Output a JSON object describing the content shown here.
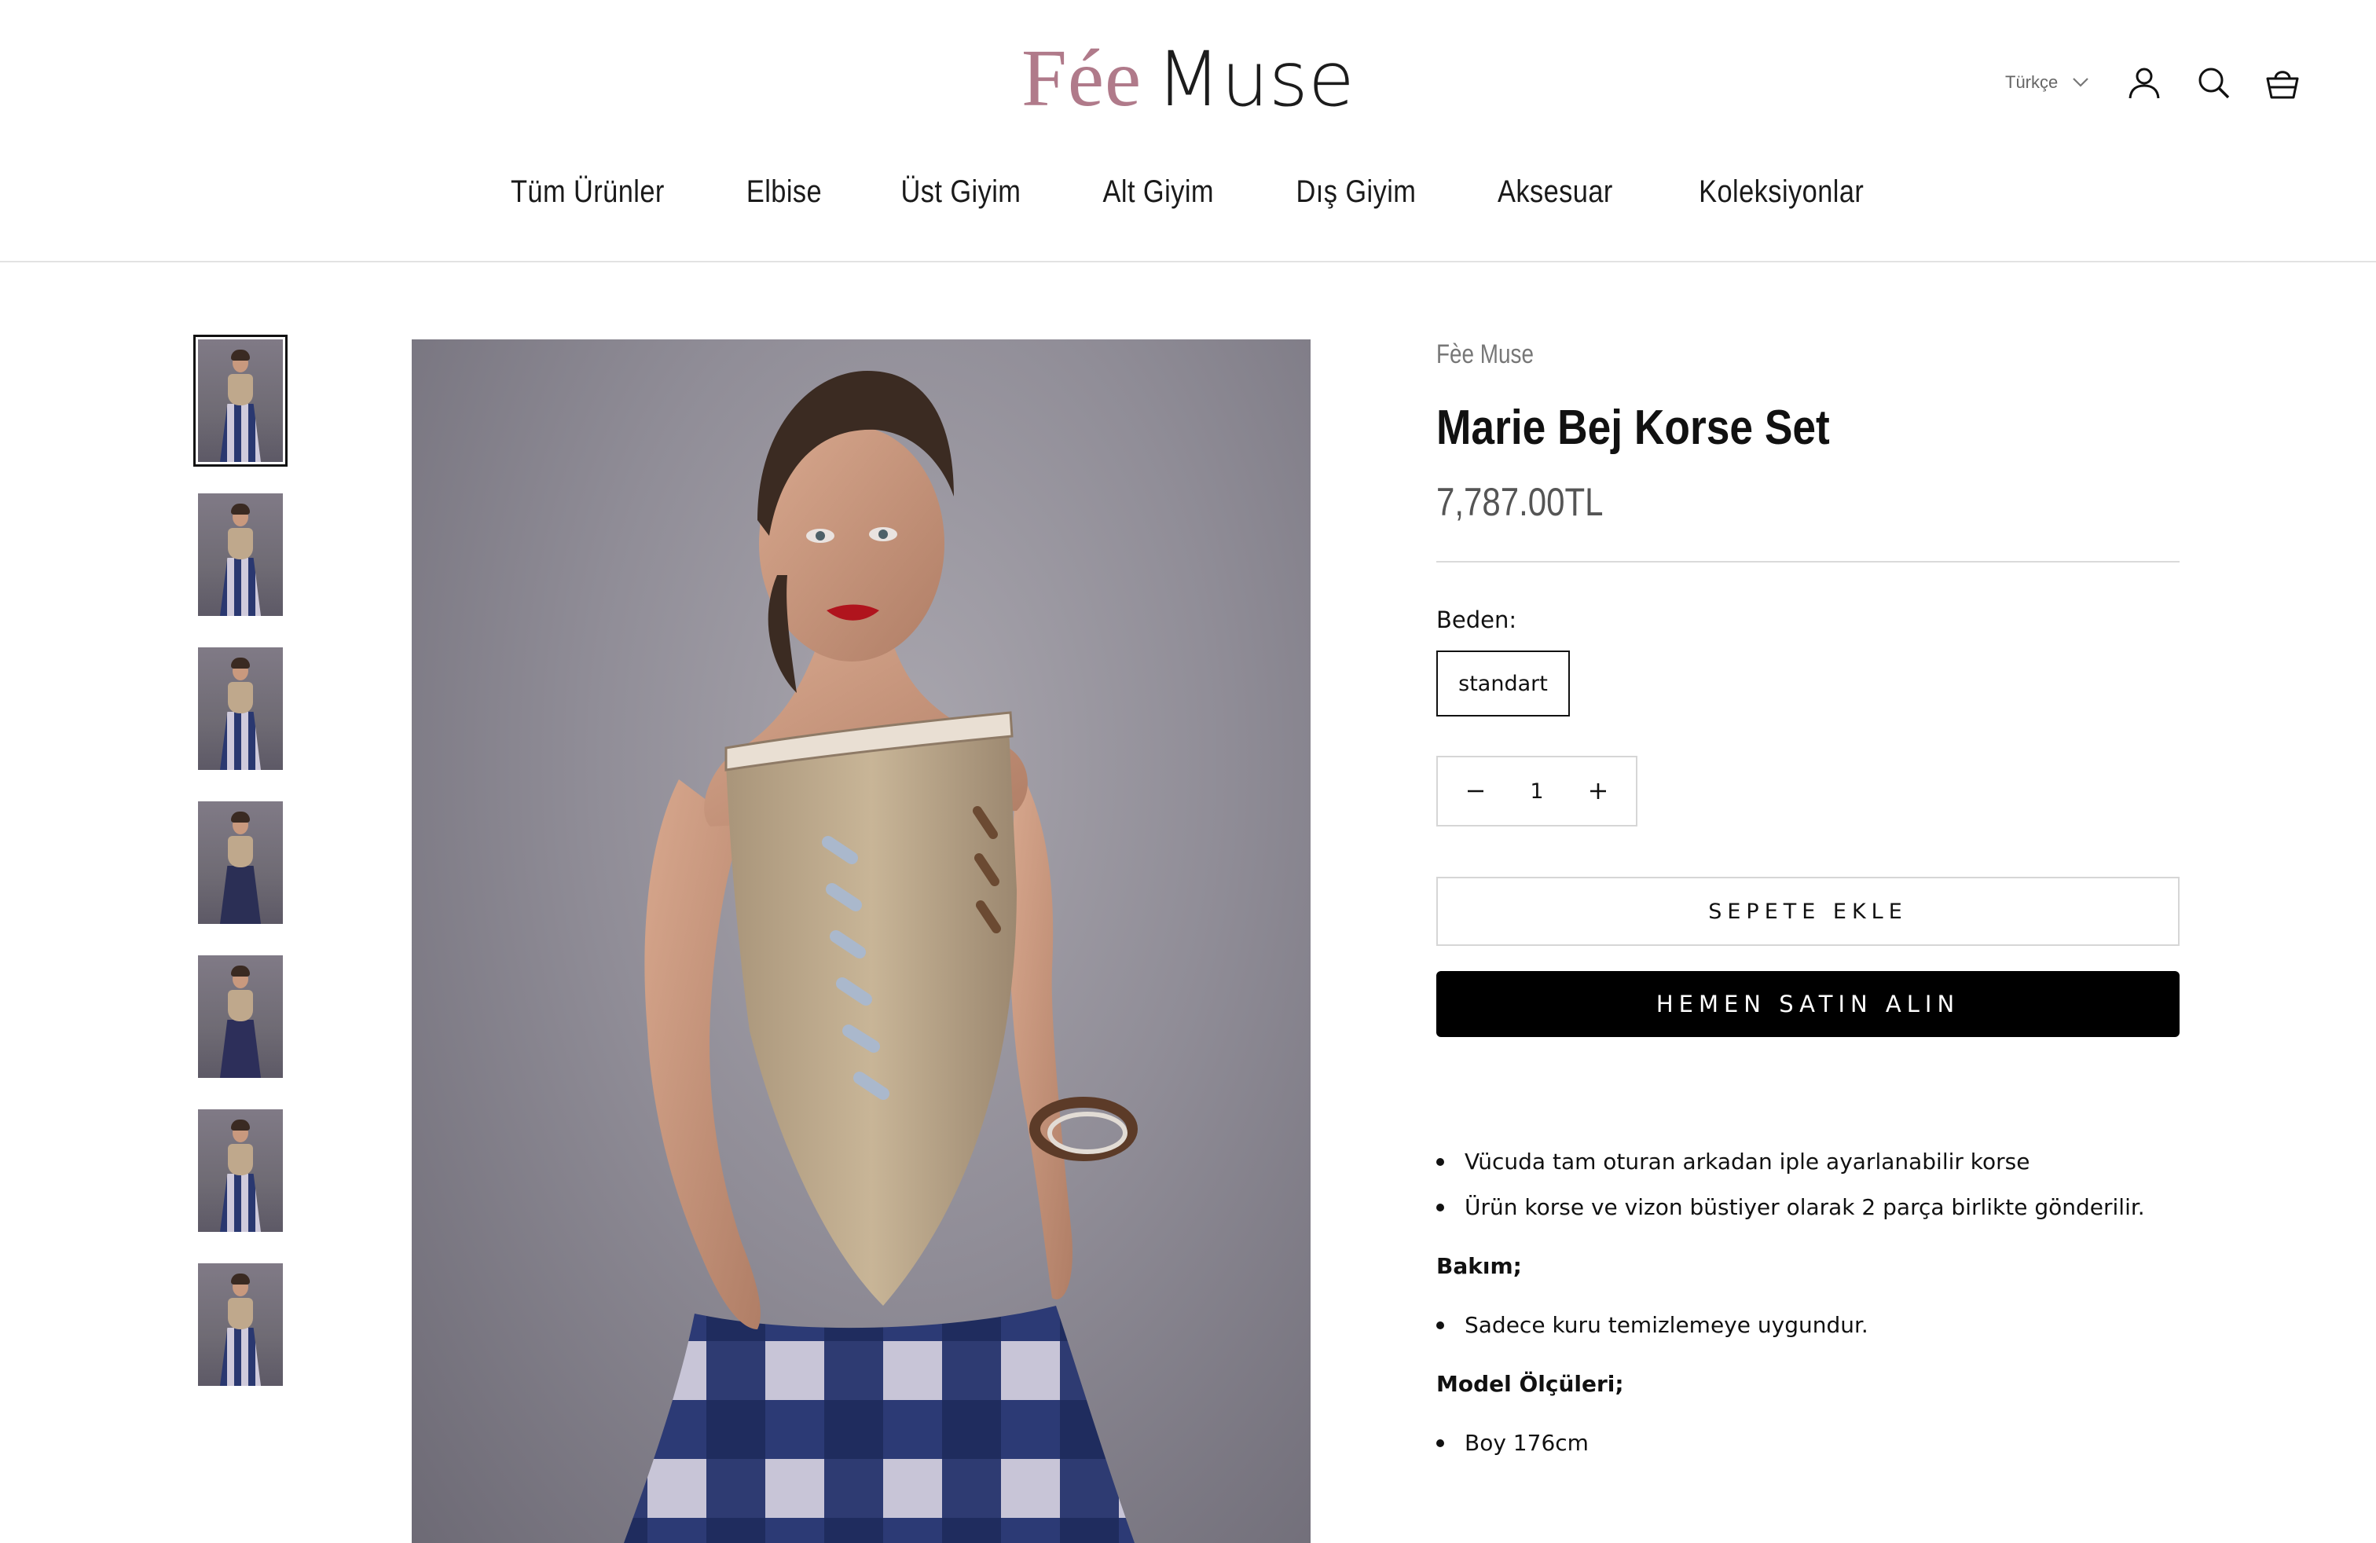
{
  "header": {
    "logo_part1": "Fée",
    "logo_part2": "Muse",
    "language": "Türkçe",
    "icons": [
      "account-icon",
      "search-icon",
      "cart-icon"
    ]
  },
  "nav": [
    "Tüm Ürünler",
    "Elbise",
    "Üst Giyim",
    "Alt Giyim",
    "Dış Giyim",
    "Aksesuar",
    "Koleksiyonlar"
  ],
  "gallery": {
    "thumbnail_count": 7,
    "active_index": 0
  },
  "product": {
    "vendor": "Fèe Muse",
    "title": "Marie Bej Korse Set",
    "price": "7,787.00TL",
    "size_label": "Beden:",
    "size_option": "standart",
    "quantity": "1",
    "add_to_cart": "SEPETE EKLE",
    "buy_now": "HEMEN SATIN ALIN"
  },
  "description": {
    "features": [
      "Vücuda tam oturan arkadan iple ayarlanabilir korse",
      "Ürün korse ve vizon büstiyer olarak 2 parça birlikte gönderilir."
    ],
    "care_heading": "Bakım;",
    "care": [
      "Sadece kuru temizlemeye uygundur."
    ],
    "model_heading": "Model Ölçüleri;",
    "model": [
      "Boy 176cm"
    ]
  },
  "colors": {
    "brand_pink": "#b07a8a",
    "button_black": "#000000",
    "border_gray": "#d6d6d6"
  }
}
